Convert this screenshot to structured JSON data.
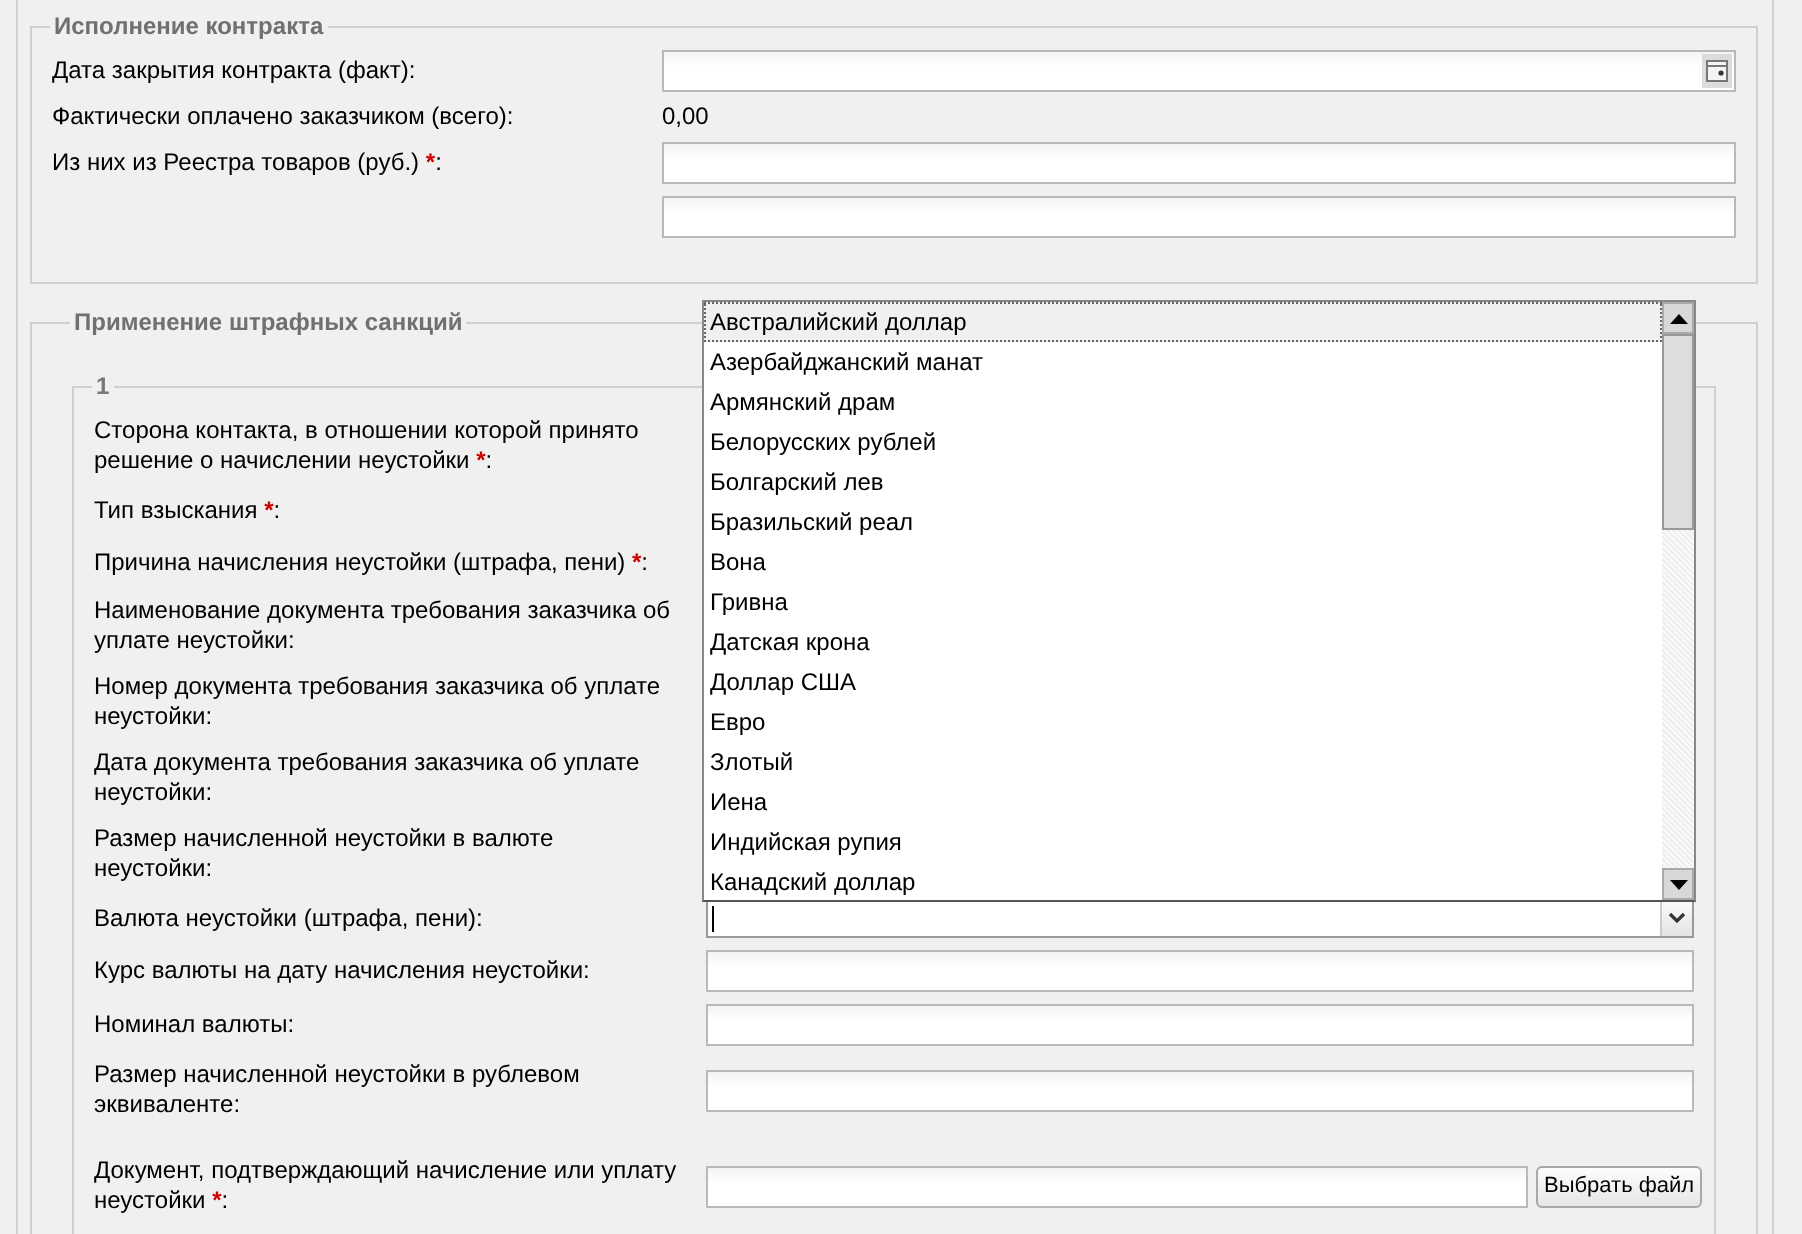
{
  "sections": [
    {
      "legend": "Исполнение контракта",
      "fields": [
        {
          "label": "Дата закрытия контракта (факт)",
          "suffix": ":",
          "kind": "date"
        },
        {
          "label": "Фактически оплачено заказчиком (всего):",
          "kind": "value",
          "value": "0,00"
        },
        {
          "label": "Из них из Реестра товаров (руб.)",
          "required": "*",
          "suffix": ":",
          "kind": "text"
        },
        {
          "kind": "text"
        }
      ]
    },
    {
      "legend": "Применение штрафных санкций",
      "groups": [
        {
          "legend": "1",
          "fields": [
            {
              "label": "Сторона контакта, в отношении которой принято решение о начислении неустойки",
              "required": "*",
              "suffix": ":"
            },
            {
              "label": "Тип взыскания",
              "required": "*",
              "suffix": ":"
            },
            {
              "label": "Причина начисления неустойки (штрафа, пени)",
              "required": "*",
              "suffix": ":"
            },
            {
              "label": "Наименование документа требования заказчика об уплате неустойки:"
            },
            {
              "label": "Номер документа требования заказчика об уплате неустойки:"
            },
            {
              "label": "Дата документа требования заказчика об уплате неустойки:"
            },
            {
              "label": "Размер начисленной неустойки в валюте неустойки:"
            },
            {
              "label": "Валюта неустойки (штрафа, пени):",
              "kind": "select"
            },
            {
              "label": "Курс валюты на дату начисления неустойки:",
              "kind": "text"
            },
            {
              "label": "Номинал валюты:",
              "kind": "text"
            },
            {
              "label": "Размер начисленной неустойки в рублевом эквиваленте:",
              "kind": "text"
            },
            {
              "label": "Документ, подтверждающий начисление или уплату неустойки",
              "required": "*",
              "suffix": ":",
              "kind": "file",
              "button": "Выбрать файл"
            }
          ]
        }
      ]
    }
  ],
  "currency_list": {
    "items": [
      {
        "label": "Австралийский доллар",
        "selected": true
      },
      {
        "label": "Азербайджанский манат",
        "selected": false
      },
      {
        "label": "Армянский драм",
        "selected": false
      },
      {
        "label": "Белорусских рублей",
        "selected": false
      },
      {
        "label": "Болгарский лев",
        "selected": false
      },
      {
        "label": "Бразильский реал",
        "selected": false
      },
      {
        "label": "Вона",
        "selected": false
      },
      {
        "label": "Гривна",
        "selected": false
      },
      {
        "label": "Датская крона",
        "selected": false
      },
      {
        "label": "Доллар США",
        "selected": false
      },
      {
        "label": "Евро",
        "selected": false
      },
      {
        "label": "Злотый",
        "selected": false
      },
      {
        "label": "Иена",
        "selected": false
      },
      {
        "label": "Индийская рупия",
        "selected": false
      },
      {
        "label": "Канадский доллар",
        "selected": false
      }
    ]
  }
}
